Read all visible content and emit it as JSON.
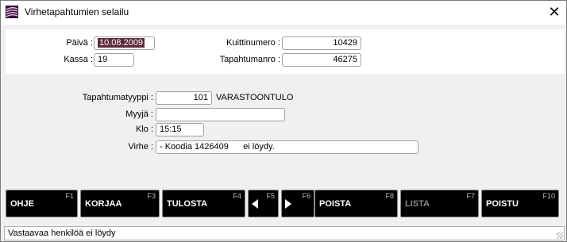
{
  "window": {
    "title": "Virhetapahtumien selailu",
    "close_glyph": "✕"
  },
  "top": {
    "paiva_label": "Päivä :",
    "paiva_value": "10.08.2009",
    "kassa_label": "Kassa :",
    "kassa_value": "19",
    "kuittinumero_label": "Kuittinumero :",
    "kuittinumero_value": "10429",
    "tapahtumanro_label": "Tapahtumanro :",
    "tapahtumanro_value": "46275"
  },
  "details": {
    "tyyppi_label": "Tapahtumatyyppi :",
    "tyyppi_value": "101",
    "tyyppi_text": "VARASTOONTULO",
    "myyja_label": "Myyjä :",
    "myyja_value": "",
    "klo_label": "Klo :",
    "klo_value": "15:15",
    "virhe_label": "Virhe :",
    "virhe_value": "- Koodia 1426409      ei löydy."
  },
  "fkeys": [
    {
      "key": "F1",
      "label": "OHJE",
      "enabled": true
    },
    {
      "key": "F3",
      "label": "KORJAA",
      "enabled": true
    },
    {
      "key": "F4",
      "label": "TULOSTA",
      "enabled": true
    },
    {
      "key": "F5",
      "label": "",
      "icon": "arrow-left-icon",
      "enabled": true
    },
    {
      "key": "F6",
      "label": "",
      "icon": "arrow-right-icon",
      "enabled": true
    },
    {
      "key": "F8",
      "label": "POISTA",
      "enabled": true
    },
    {
      "key": "F7",
      "label": "LISTA",
      "enabled": false
    },
    {
      "key": "F10",
      "label": "POISTU",
      "enabled": true
    }
  ],
  "status": {
    "message": "Vastaavaa henkilöä ei löydy"
  },
  "colors": {
    "selection": "#5a2a3a",
    "fkey_bg": "#000000",
    "window_bg": "#f0f0f0"
  }
}
